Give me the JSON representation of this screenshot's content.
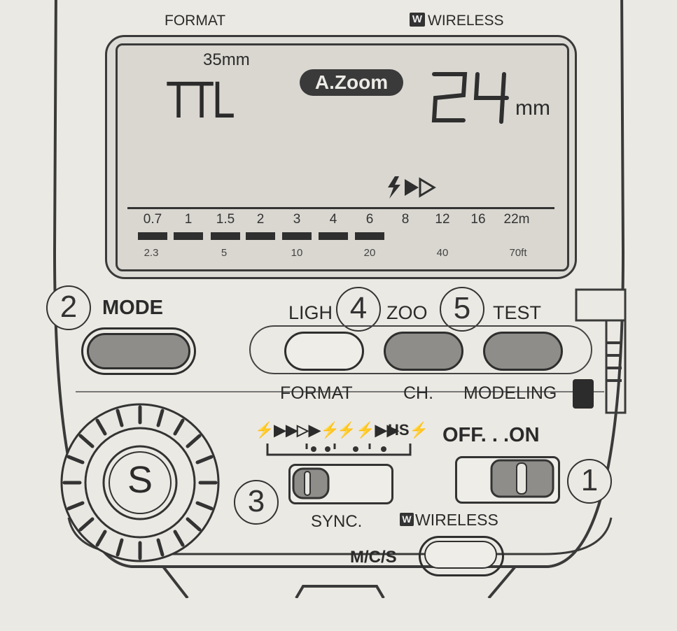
{
  "top_labels": {
    "format": "FORMAT",
    "wireless": "WIRELESS",
    "wireless_badge": "W"
  },
  "lcd": {
    "film_format": "35mm",
    "mode": "TTL",
    "zoom_mode": "A.Zoom",
    "zoom_value": "24",
    "zoom_unit": "mm",
    "meter_scale": [
      "0.7",
      "1",
      "1.5",
      "2",
      "3",
      "4",
      "6",
      "8",
      "12",
      "16",
      "22m"
    ],
    "feet_scale": [
      "2.3",
      "5",
      "10",
      "20",
      "40",
      "70ft"
    ],
    "range_bars_filled": 7
  },
  "buttons": {
    "mode": "MODE",
    "light": "LIGH",
    "zoom": "ZOO",
    "test": "TEST",
    "format": "FORMAT",
    "ch": "CH.",
    "modeling": "MODELING",
    "mcs": "M/C/S"
  },
  "callouts": [
    "1",
    "2",
    "3",
    "4",
    "5"
  ],
  "dial": {
    "label": "S"
  },
  "sync": {
    "options": [
      "⚡▶▶",
      "▷▶⚡",
      "⚡⚡▶▶",
      "HS⚡"
    ],
    "label": "SYNC.",
    "wireless_label": "WIRELESS",
    "wireless_badge": "W"
  },
  "power": {
    "label": "OFF. . .ON"
  }
}
